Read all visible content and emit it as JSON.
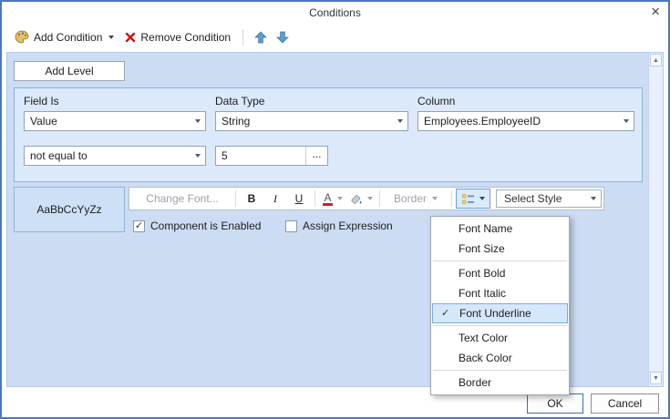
{
  "dialog": {
    "title": "Conditions"
  },
  "icons": {
    "close": "×",
    "check": "✓",
    "scroll_up": "▲",
    "scroll_down": "▼"
  },
  "toolbar": {
    "add_condition_label": "Add Condition",
    "remove_condition_label": "Remove Condition"
  },
  "panel": {
    "add_level_label": "Add Level",
    "condition": {
      "field_is_label": "Field Is",
      "data_type_label": "Data Type",
      "column_label": "Column",
      "field_is_value": "Value",
      "data_type_value": "String",
      "column_value": "Employees.EmployeeID",
      "operator_value": "not equal to",
      "value": "5",
      "browse_label": "..."
    },
    "format": {
      "preview_text": "AaBbCcYyZz",
      "change_font_label": "Change Font...",
      "bold_label": "B",
      "italic_label": "I",
      "underline_label": "U",
      "text_color_label": "A",
      "border_label": "Border",
      "select_style_value": "Select Style"
    },
    "component_enabled_label": "Component is Enabled",
    "assign_expression_label": "Assign Expression"
  },
  "menu": {
    "items": [
      {
        "label": "Font Name",
        "checked": false
      },
      {
        "label": "Font Size",
        "checked": false
      },
      {
        "label": "Font Bold",
        "checked": false
      },
      {
        "label": "Font Italic",
        "checked": false
      },
      {
        "label": "Font Underline",
        "checked": true
      },
      {
        "label": "Text Color",
        "checked": false
      },
      {
        "label": "Back Color",
        "checked": false
      },
      {
        "label": "Border",
        "checked": false
      }
    ]
  },
  "footer": {
    "ok_label": "OK",
    "cancel_label": "Cancel"
  },
  "colors": {
    "dialog_border": "#4a79bb",
    "panel_background": "#cbdcf3",
    "condition_box_background": "#dbe9fa",
    "condition_box_border": "#8fb2dc",
    "menu_highlight_background": "#d5e7fb",
    "menu_highlight_border": "#7ea9da",
    "remove_icon_color": "#cc1111",
    "text_color_underline": "#cc2222",
    "arrow_accent": "#5b9bd5"
  }
}
